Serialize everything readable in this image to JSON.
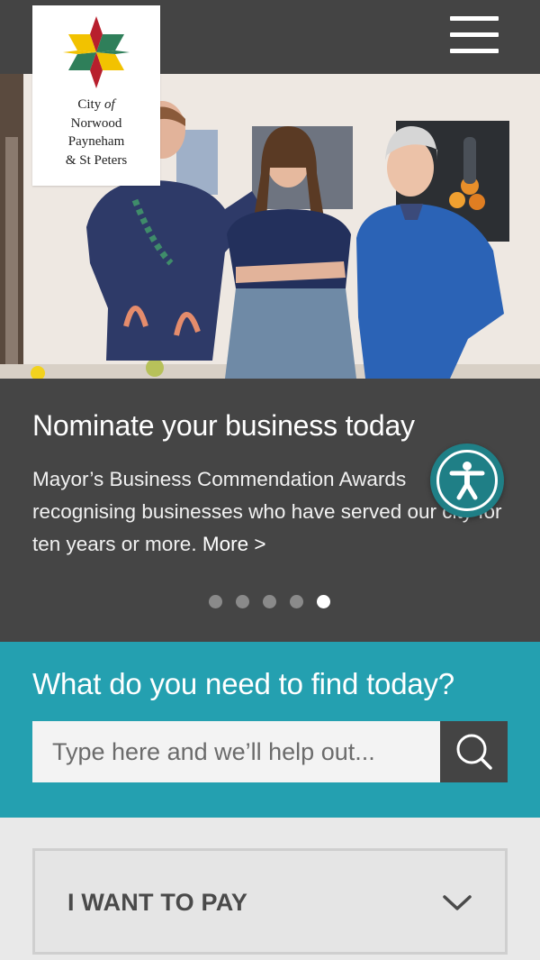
{
  "header": {
    "logo_lines": [
      "City",
      "of",
      "Norwood",
      "Payneham",
      "& St Peters"
    ],
    "menu_icon": "hamburger-menu-icon"
  },
  "hero": {
    "image_description_icon": "hero-photo"
  },
  "slide": {
    "title": "Nominate your business today",
    "description": "Mayor’s Business Commendation Awards recognising businesses who have served our city for ten years or more.",
    "more_link": "More >",
    "slide_count": 5,
    "active_slide": 5
  },
  "accessibility": {
    "icon": "accessibility-icon"
  },
  "search": {
    "title": "What do you need to find today?",
    "placeholder": "Type here and we’ll help out...",
    "value": "",
    "button_icon": "search-icon"
  },
  "accordion": {
    "label": "I WANT TO PAY",
    "icon": "chevron-down-icon"
  },
  "colors": {
    "header_bg": "#444444",
    "slide_bg": "#454545",
    "search_bg": "#24a0b0",
    "accessibility_bg": "#1f7f86",
    "page_bg": "#e9e9e9"
  }
}
